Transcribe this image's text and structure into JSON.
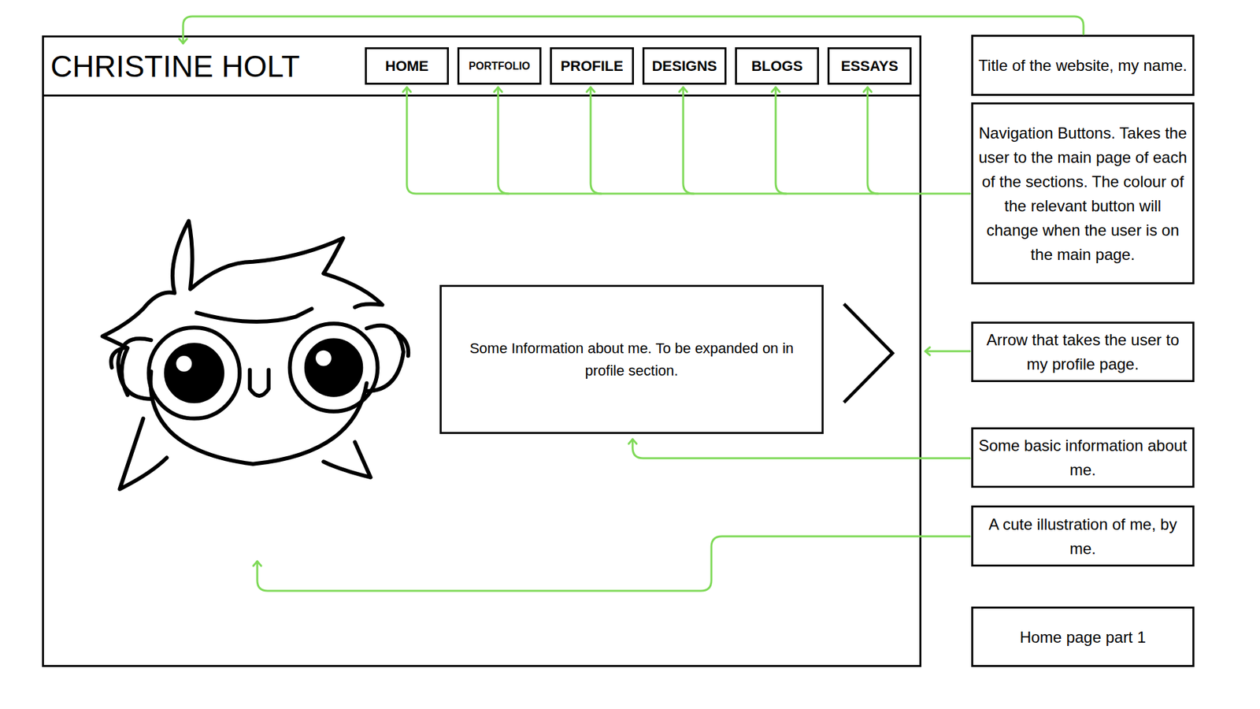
{
  "header": {
    "title": "CHRISTINE HOLT",
    "nav": [
      "HOME",
      "PORTFOLIO",
      "PROFILE",
      "DESIGNS",
      "BLOGS",
      "ESSAYS"
    ]
  },
  "content": {
    "info": "Some Information about me. To be expanded on in profile section."
  },
  "annotations": [
    "Title of the website, my name.",
    "Navigation Buttons. Takes the user to the main page of each of the sections. The colour of the relevant button will change when the user is on the main page.",
    "Arrow that takes the user to my profile page.",
    "Some basic information about me.",
    "A cute illustration of me, by me.",
    "Home page part 1"
  ]
}
